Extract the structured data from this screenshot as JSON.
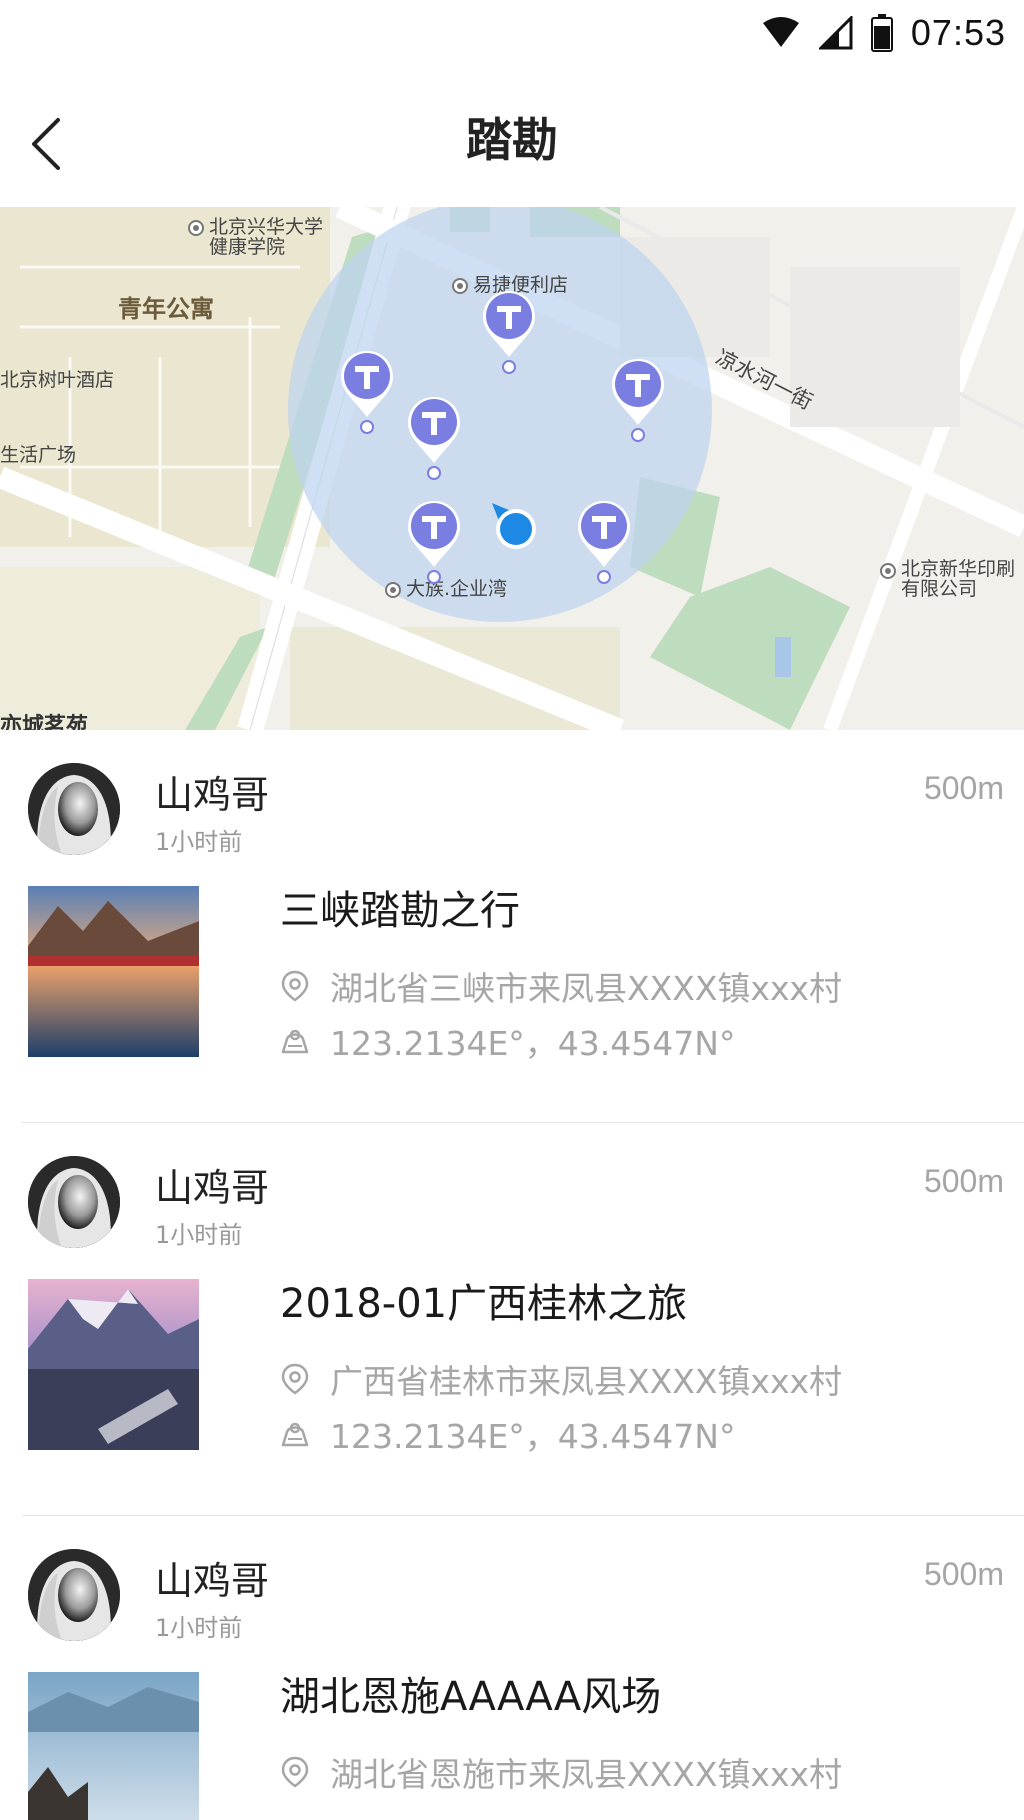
{
  "status_bar": {
    "time": "07:53"
  },
  "header": {
    "title": "踏勘"
  },
  "map": {
    "labels": {
      "school": "北京兴华大学\n健康学院",
      "district": "青年公寓",
      "hotel": "北京树叶酒店",
      "plaza": "生活广场",
      "store": "易捷便利店",
      "street": "凉水河一街",
      "company": "大族.企业湾",
      "printer": "北京新华印刷\n有限公司",
      "bottom": "亦城茗苑"
    },
    "colors": {
      "radius_fill": "#c9dcf2",
      "pin": "#7a7ee0",
      "location": "#1e88e5",
      "green": "#bcdcc0"
    }
  },
  "posts": [
    {
      "user": "山鸡哥",
      "time": "1小时前",
      "distance": "500m",
      "title": "三峡踏勘之行",
      "address": "湖北省三峡市来凤县XXXX镇xxx村",
      "coords": "123.2134E°，43.4547N°"
    },
    {
      "user": "山鸡哥",
      "time": "1小时前",
      "distance": "500m",
      "title": "2018-01广西桂林之旅",
      "address": "广西省桂林市来凤县XXXX镇xxx村",
      "coords": "123.2134E°，43.4547N°"
    },
    {
      "user": "山鸡哥",
      "time": "1小时前",
      "distance": "500m",
      "title": "湖北恩施AAAAA风场",
      "address": "湖北省恩施市来凤县XXXX镇xxx村",
      "coords": ""
    }
  ]
}
